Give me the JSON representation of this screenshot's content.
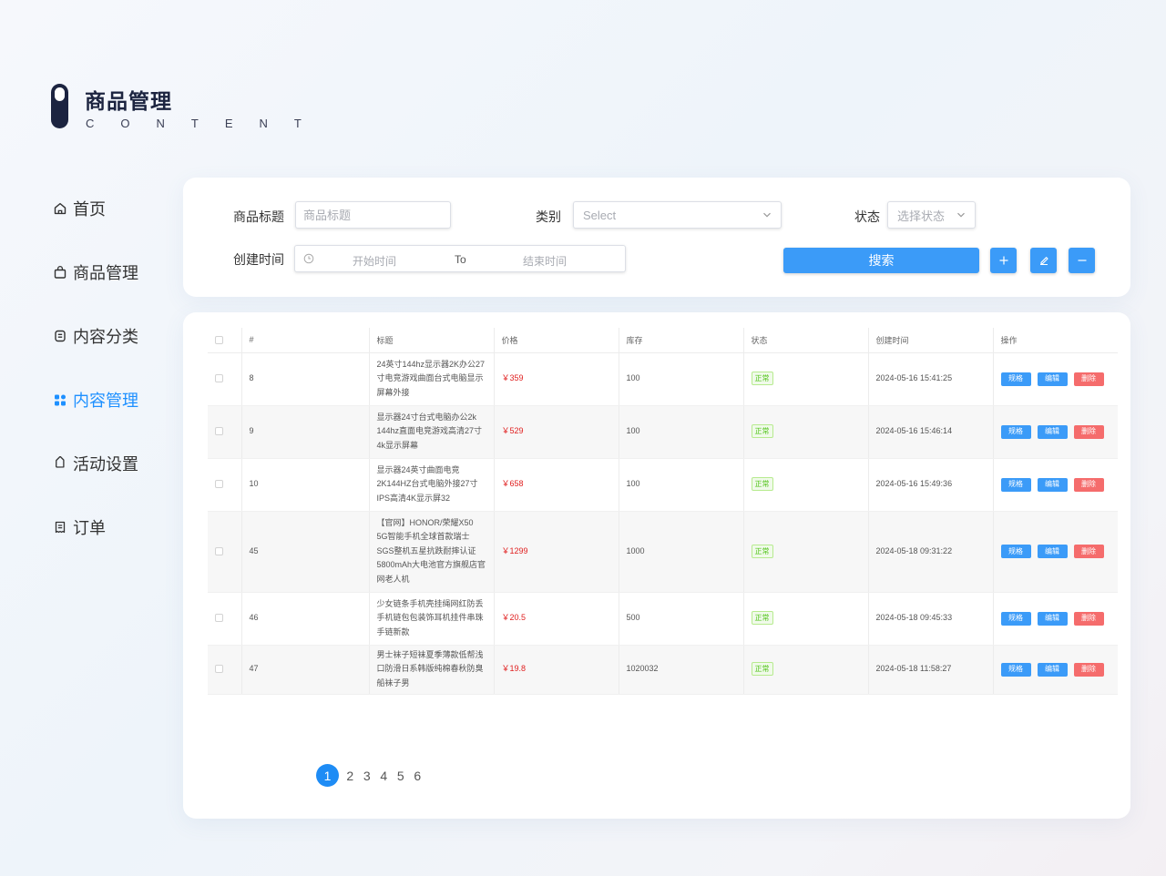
{
  "logo": {
    "title": "商品管理",
    "subtitle": "CONTENT"
  },
  "sidebar": {
    "items": [
      {
        "label": "首页",
        "icon": "home-icon",
        "active": false
      },
      {
        "label": "商品管理",
        "icon": "bag-icon",
        "active": false
      },
      {
        "label": "内容分类",
        "icon": "list-box-icon",
        "active": false
      },
      {
        "label": "内容管理",
        "icon": "grid-icon",
        "active": true
      },
      {
        "label": "活动设置",
        "icon": "tag-icon",
        "active": false
      },
      {
        "label": "订单",
        "icon": "receipt-icon",
        "active": false
      }
    ]
  },
  "filters": {
    "title_label": "商品标题",
    "title_placeholder": "商品标题",
    "category_label": "类别",
    "category_value": "Select",
    "status_label": "状态",
    "status_value": "选择状态",
    "time_label": "创建时间",
    "start_placeholder": "开始时间",
    "range_separator": "To",
    "end_placeholder": "结束时间",
    "search_label": "搜索"
  },
  "table": {
    "columns": [
      "#",
      "标题",
      "价格",
      "库存",
      "状态",
      "创建时间",
      "操作"
    ],
    "rows": [
      {
        "id": "8",
        "title": "24英寸144hz显示器2K办公27寸电竞游戏曲面台式电脑显示屏幕外接",
        "price": "￥359",
        "stock": "100",
        "status": "正常",
        "created": "2024-05-16 15:41:25"
      },
      {
        "id": "9",
        "title": "显示器24寸台式电脑办公2k 144hz直面电竞游戏高清27寸4k显示屏幕",
        "price": "￥529",
        "stock": "100",
        "status": "正常",
        "created": "2024-05-16 15:46:14"
      },
      {
        "id": "10",
        "title": "显示器24英寸曲面电竞2K144HZ台式电脑外接27寸IPS高清4K显示屏32",
        "price": "￥658",
        "stock": "100",
        "status": "正常",
        "created": "2024-05-16 15:49:36"
      },
      {
        "id": "45",
        "title": "【官网】HONOR/荣耀X50 5G智能手机全球首款瑞士SGS整机五星抗跌耐摔认证5800mAh大电池官方旗舰店官网老人机",
        "price": "￥1299",
        "stock": "1000",
        "status": "正常",
        "created": "2024-05-18 09:31:22"
      },
      {
        "id": "46",
        "title": "少女链条手机壳挂绳网红防丢手机链包包装饰耳机挂件串珠手链新款",
        "price": "￥20.5",
        "stock": "500",
        "status": "正常",
        "created": "2024-05-18 09:45:33"
      },
      {
        "id": "47",
        "title": "男士袜子短袜夏季薄款低帮浅口防滑日系韩版纯棉春秋防臭船袜子男",
        "price": "￥19.8",
        "stock": "1020032",
        "status": "正常",
        "created": "2024-05-18 11:58:27"
      }
    ],
    "actions": {
      "spec": "规格",
      "edit": "编辑",
      "delete": "删除"
    }
  },
  "pagination": {
    "pages": [
      "1",
      "2",
      "3",
      "4",
      "5",
      "6"
    ],
    "current": "1"
  },
  "colors": {
    "accent": "#1e8cf5",
    "button": "#3b9bf8",
    "danger": "#f56c6c",
    "price": "#e02020",
    "brand_dark": "#1c2440"
  }
}
